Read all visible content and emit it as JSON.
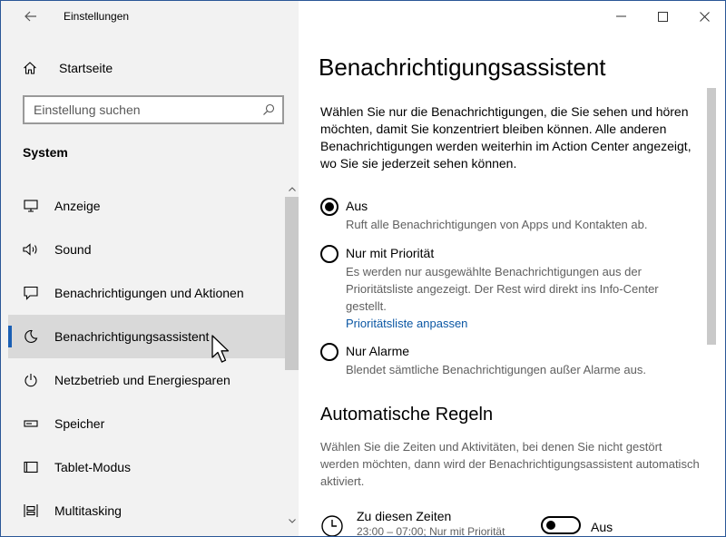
{
  "app": {
    "title": "Einstellungen"
  },
  "sidebar": {
    "home_label": "Startseite",
    "search_placeholder": "Einstellung suchen",
    "section_title": "System",
    "items": [
      {
        "label": "Anzeige",
        "icon": "monitor-icon"
      },
      {
        "label": "Sound",
        "icon": "speaker-icon"
      },
      {
        "label": "Benachrichtigungen und Aktionen",
        "icon": "message-icon"
      },
      {
        "label": "Benachrichtigungsassistent",
        "icon": "moon-icon",
        "selected": true
      },
      {
        "label": "Netzbetrieb und Energiesparen",
        "icon": "power-icon"
      },
      {
        "label": "Speicher",
        "icon": "storage-icon"
      },
      {
        "label": "Tablet-Modus",
        "icon": "tablet-icon"
      },
      {
        "label": "Multitasking",
        "icon": "multitasking-icon"
      }
    ]
  },
  "main": {
    "page_title": "Benachrichtigungsassistent",
    "intro": "Wählen Sie nur die Benachrichtigungen, die Sie sehen und hören möchten, damit Sie konzentriert bleiben können. Alle anderen Benachrichtigungen werden weiterhin im Action Center angezeigt, wo Sie sie jederzeit sehen können.",
    "options": [
      {
        "label": "Aus",
        "description": "Ruft alle Benachrichtigungen von Apps und Kontakten ab.",
        "checked": true
      },
      {
        "label": "Nur mit Priorität",
        "description": "Es werden nur ausgewählte Benachrichtigungen aus der Prioritätsliste angezeigt. Der Rest wird direkt ins Info-Center gestellt.",
        "link": "Prioritätsliste anpassen",
        "checked": false
      },
      {
        "label": "Nur Alarme",
        "description": "Blendet sämtliche Benachrichtigungen außer Alarme aus.",
        "checked": false
      }
    ],
    "rules_title": "Automatische Regeln",
    "rules_description": "Wählen Sie die Zeiten und Aktivitäten, bei denen Sie nicht gestört werden möchten, dann wird der Benachrichtigungsassistent automatisch aktiviert.",
    "rule": {
      "title": "Zu diesen Zeiten",
      "subtitle": "23:00 – 07:00; Nur mit Priorität",
      "toggle_label": "Aus",
      "toggle_on": false
    }
  },
  "colors": {
    "accent": "#1a5fb4",
    "link": "#0b57a4",
    "sidebar_bg": "#f2f2f2",
    "selected_bg": "#d9d9d9"
  }
}
